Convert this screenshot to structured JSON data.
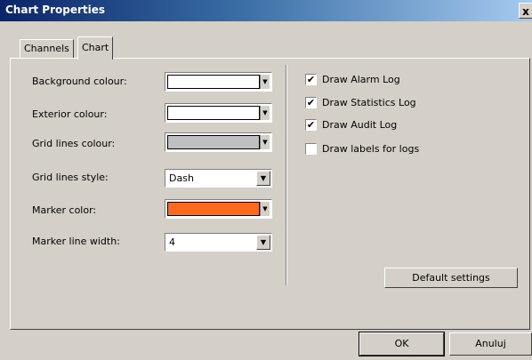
{
  "window": {
    "title": "Chart Properties",
    "close_label": "x"
  },
  "tabs": [
    {
      "label": "Channels",
      "active": false
    },
    {
      "label": "Chart",
      "active": true
    }
  ],
  "settings": {
    "background_colour": {
      "label": "Background colour:",
      "color": "#ffffff"
    },
    "exterior_colour": {
      "label": "Exterior colour:",
      "color": "#ffffff"
    },
    "grid_lines_colour": {
      "label": "Grid lines colour:",
      "color": "#c0c0c0"
    },
    "grid_lines_style": {
      "label": "Grid lines style:",
      "value": "Dash"
    },
    "marker_color": {
      "label": "Marker color:",
      "color": "#ff6a1f"
    },
    "marker_line_width": {
      "label": "Marker line width:",
      "value": "4"
    }
  },
  "options": [
    {
      "label": "Draw Alarm Log",
      "checked": true
    },
    {
      "label": "Draw Statistics Log",
      "checked": true
    },
    {
      "label": "Draw Audit Log",
      "checked": true
    },
    {
      "label": "Draw labels for logs",
      "checked": false
    }
  ],
  "buttons": {
    "default_settings": "Default settings",
    "ok": "OK",
    "cancel": "Anuluj"
  },
  "glyphs": {
    "dropdown_arrow": "▼",
    "check_mark": "✔"
  }
}
